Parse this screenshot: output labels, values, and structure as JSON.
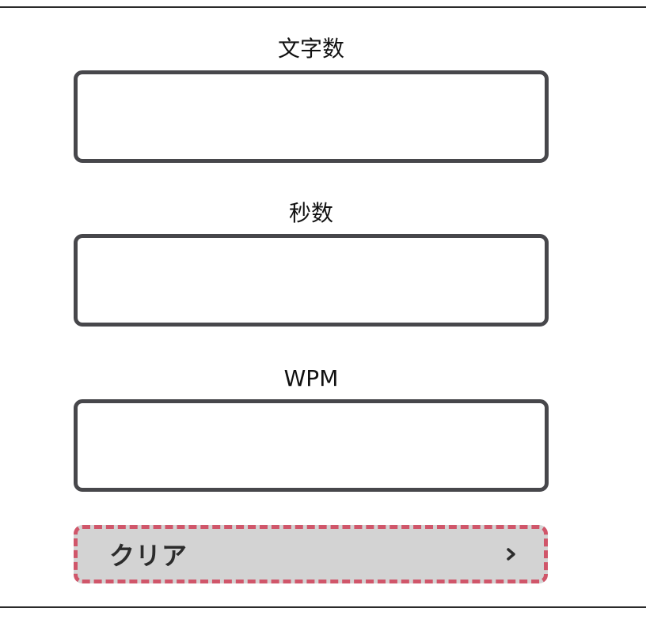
{
  "fields": {
    "chars": {
      "label": "文字数",
      "value": "",
      "placeholder": ""
    },
    "seconds": {
      "label": "秒数",
      "value": "",
      "placeholder": ""
    },
    "wpm": {
      "label": "WPM",
      "value": "",
      "placeholder": ""
    }
  },
  "clear_button": {
    "label": "クリア",
    "icon": "chevron-right-icon"
  },
  "colors": {
    "input_border": "#47474b",
    "button_background": "#d3d3d3",
    "button_dashed_border": "#d0566a"
  }
}
